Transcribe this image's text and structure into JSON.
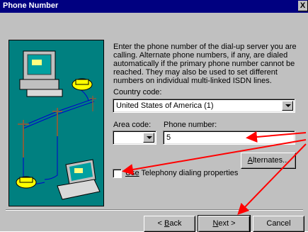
{
  "window": {
    "title": "Phone Number",
    "close_glyph": "X"
  },
  "description": "Enter the phone number of the dial-up server you are calling.  Alternate phone numbers, if any, are dialed automatically if the primary phone number cannot be reached.  They may also be used to set different numbers on individual multi-linked ISDN lines.",
  "country": {
    "label": "Country code:",
    "value": "United States of America (1)"
  },
  "area": {
    "label": "Area code:",
    "value": ""
  },
  "phone": {
    "label": "Phone number:",
    "value": "5"
  },
  "alternates_button": {
    "label_underlined": "A",
    "label_rest": "lternates..."
  },
  "telephony": {
    "label_prefix": "Use",
    "label_rest": " Telephony dialing properties",
    "checked": false
  },
  "buttons": {
    "back": {
      "prefix": "< ",
      "underlined": "B",
      "rest": "ack"
    },
    "next": {
      "underlined": "N",
      "rest": "ext >"
    },
    "cancel": "Cancel"
  },
  "colors": {
    "title_bar": "#000080",
    "dialog": "#c0c0c0",
    "art_bg": "#008080",
    "annotation_arrow": "#ff0000"
  },
  "icons": [
    "computer-icon",
    "telephone-icon",
    "telephone-pole-icon",
    "laptop-icon",
    "close-icon",
    "dropdown-arrow-icon"
  ]
}
